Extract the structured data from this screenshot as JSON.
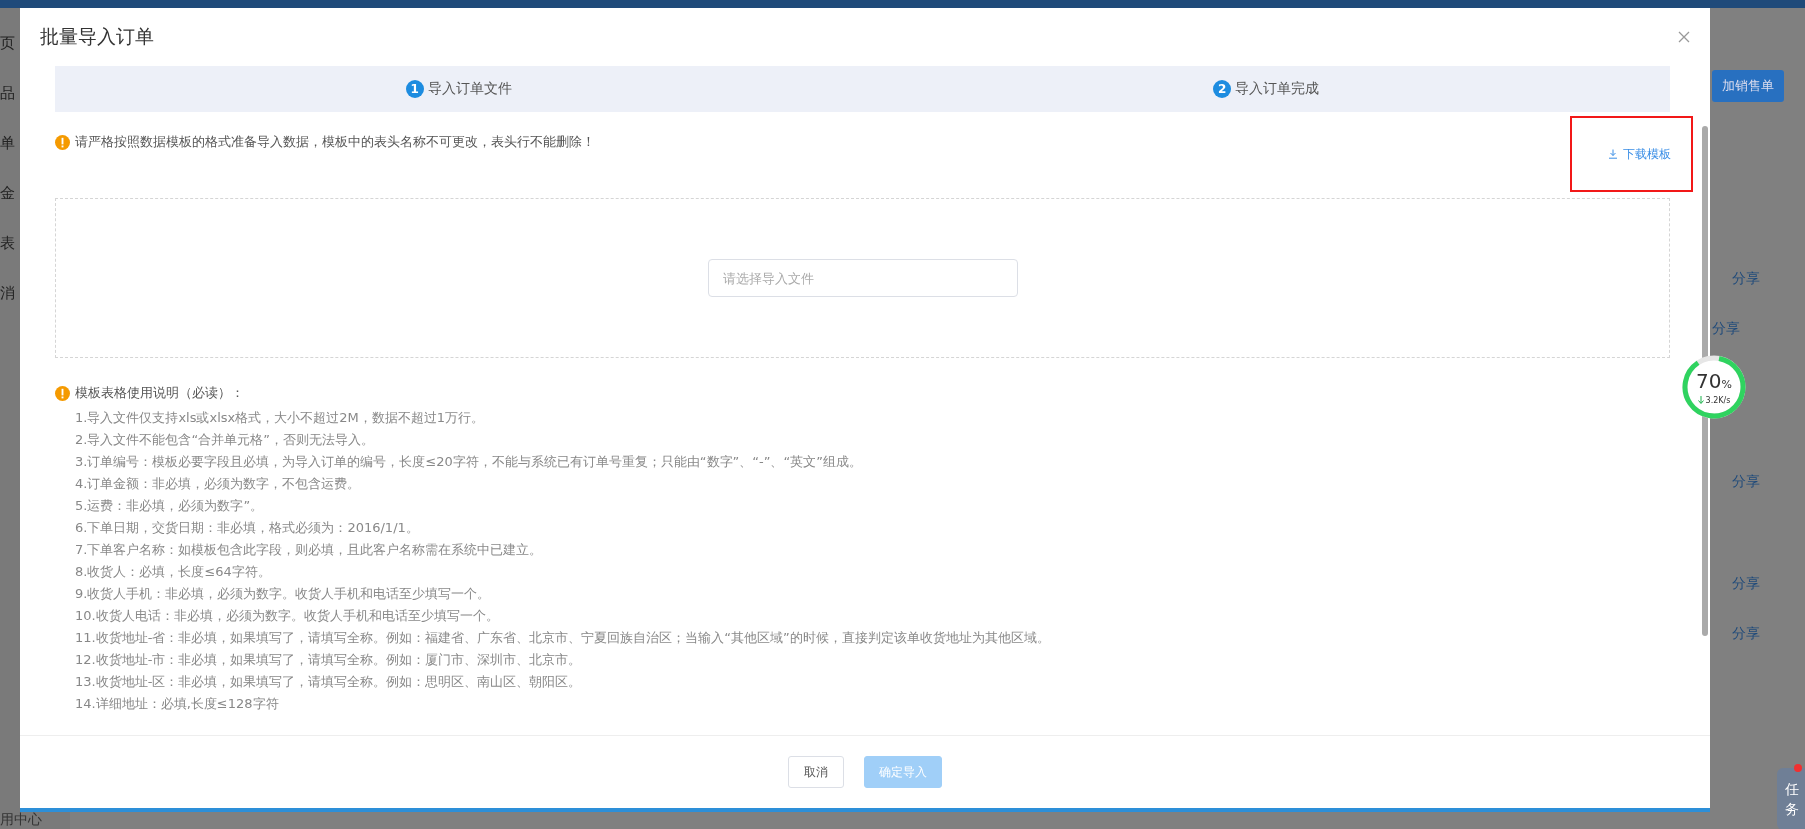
{
  "background": {
    "sidebar_items": [
      "页",
      "品",
      "单",
      "金",
      "表",
      "消"
    ],
    "sidebar_footer": "用中心",
    "add_button": "加销售单",
    "share_links": [
      "分享",
      "分享",
      "分享",
      "分享",
      "分享"
    ]
  },
  "dialog": {
    "title": "批量导入订单",
    "steps": [
      {
        "number": "1",
        "label": "导入订单文件"
      },
      {
        "number": "2",
        "label": "导入订单完成"
      }
    ],
    "warning": "请严格按照数据模板的格式准备导入数据，模板中的表头名称不可更改，表头行不能删除！",
    "download": {
      "label": "下载模板",
      "highlighted": true
    },
    "file_input": {
      "placeholder": "请选择导入文件"
    },
    "instructions_title": "模板表格使用说明（必读）：",
    "instructions": [
      "1.导入文件仅支持xls或xlsx格式，大小不超过2M，数据不超过1万行。",
      "2.导入文件不能包含“合并单元格”，否则无法导入。",
      "3.订单编号：模板必要字段且必填，为导入订单的编号，长度≤20字符，不能与系统已有订单号重复；只能由“数字”、“-”、“英文”组成。",
      "4.订单金额：非必填，必须为数字，不包含运费。",
      "5.运费：非必填，必须为数字”。",
      "6.下单日期，交货日期：非必填，格式必须为：2016/1/1。",
      "7.下单客户名称：如模板包含此字段，则必填，且此客户名称需在系统中已建立。",
      "8.收货人：必填，长度≤64字符。",
      "9.收货人手机：非必填，必须为数字。收货人手机和电话至少填写一个。",
      "10.收货人电话：非必填，必须为数字。收货人手机和电话至少填写一个。",
      "11.收货地址-省：非必填，如果填写了，请填写全称。例如：福建省、广东省、北京市、宁夏回族自治区；当输入“其他区域”的时候，直接判定该单收货地址为其他区域。",
      "12.收货地址-市：非必填，如果填写了，请填写全称。例如：厦门市、深圳市、北京市。",
      "13.收货地址-区：非必填，如果填写了，请填写全称。例如：思明区、南山区、朝阳区。",
      "14.详细地址：必填,长度≤128字符"
    ],
    "buttons": [
      {
        "label": "取消",
        "kind": "default",
        "disabled": false
      },
      {
        "label": "确定导入",
        "kind": "primary",
        "disabled": true
      }
    ]
  },
  "network_widget": {
    "percent": "70",
    "unit": "%",
    "speed": "3.2K/s"
  },
  "task_button": {
    "label": "任务",
    "notification": true
  }
}
